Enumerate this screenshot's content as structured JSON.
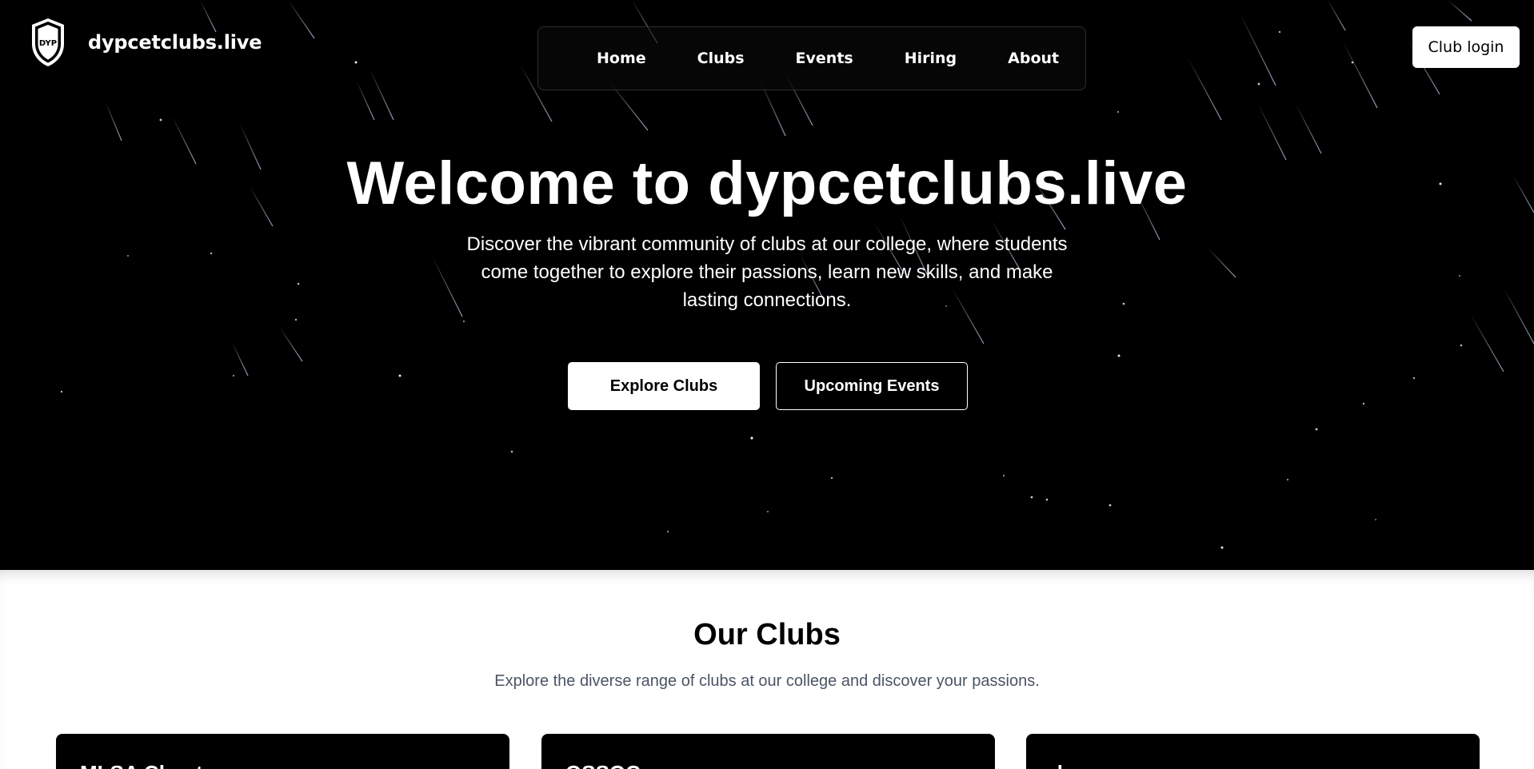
{
  "brand": {
    "name": "dypcetclubs.live",
    "logo_text": "DYP",
    "logo_icon": "shield-crest-icon"
  },
  "nav": {
    "items": [
      {
        "label": "Home"
      },
      {
        "label": "Clubs"
      },
      {
        "label": "Events"
      },
      {
        "label": "Hiring"
      },
      {
        "label": "About"
      }
    ]
  },
  "header": {
    "login_label": "Club login"
  },
  "hero": {
    "title": "Welcome to dypcetclubs.live",
    "subtitle": "Discover the vibrant community of clubs at our college, where students come together to explore their passions, learn new skills, and make lasting connections.",
    "primary_cta": "Explore Clubs",
    "secondary_cta": "Upcoming Events",
    "background": "starfield-with-meteors"
  },
  "clubs": {
    "title": "Our Clubs",
    "subtitle": "Explore the diverse range of clubs at our college and discover your passions.",
    "cards": [
      {
        "title": "MLSA Chapter"
      },
      {
        "title": "OSSOC"
      },
      {
        "title": "demo"
      }
    ]
  },
  "colors": {
    "hero_bg": "#000000",
    "text_light": "#ffffff",
    "muted_text": "#4a5565",
    "card_bg": "#000000"
  }
}
